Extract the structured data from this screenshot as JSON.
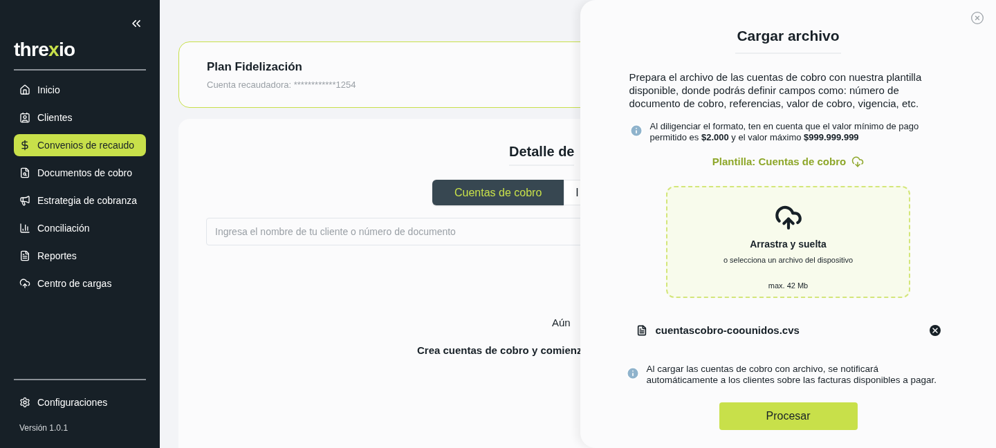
{
  "sidebar": {
    "logo": [
      {
        "text": "thre",
        "accent": false
      },
      {
        "text": "x",
        "accent": true
      },
      {
        "text": "io",
        "accent": false
      }
    ],
    "items": [
      {
        "label": "Inicio",
        "selected": false
      },
      {
        "label": "Clientes",
        "selected": false
      },
      {
        "label": "Convenios de recaudo",
        "selected": true
      },
      {
        "label": "Documentos de cobro",
        "selected": false
      },
      {
        "label": "Estrategia de cobranza",
        "selected": false
      },
      {
        "label": "Conciliación",
        "selected": false
      },
      {
        "label": "Reportes",
        "selected": false
      },
      {
        "label": "Centro de cargas",
        "selected": false
      }
    ],
    "settings": {
      "label": "Configuraciones"
    },
    "version": "Versión 1.0.1"
  },
  "plan": {
    "title": "Plan Fidelización",
    "account": "Cuenta recaudadora: ************1254"
  },
  "detail": {
    "title": "Detalle de",
    "tabs": [
      {
        "label": "Cuentas de cobro",
        "selected": true
      },
      {
        "label": "I",
        "selected": false
      }
    ],
    "search": {
      "placeholder": "Ingresa el nombre de tu cliente o número de documento"
    },
    "empty_title": "Aún",
    "empty_text": "Crea cuentas de cobro y comienz"
  },
  "drawer": {
    "title": "Cargar archivo",
    "intro": "Prepara el archivo de las cuentas de cobro con nuestra plantilla disponible, donde podrás definir campos como: número de documento de cobro, referencias, valor de cobro, vigencia, etc.",
    "note": "Al diligenciar el formato, ten en cuenta que el valor mínimo de pago permitido es **$2.000** y el valor máximo **$999.999.999**",
    "template_link": "Plantilla: Cuentas de cobro",
    "dropzone": {
      "title": "Arrastra y suelta",
      "subtitle": "o selecciona un archivo del dispositivo",
      "limit": "max. 42 Mb"
    },
    "file": {
      "name": "cuentascobro-coounidos.cvs"
    },
    "footer_note": "Al cargar las cuentas de cobro con archivo, se notificará automáticamente a los clientes sobre las facturas disponibles a pagar.",
    "submit": "Procesar"
  }
}
